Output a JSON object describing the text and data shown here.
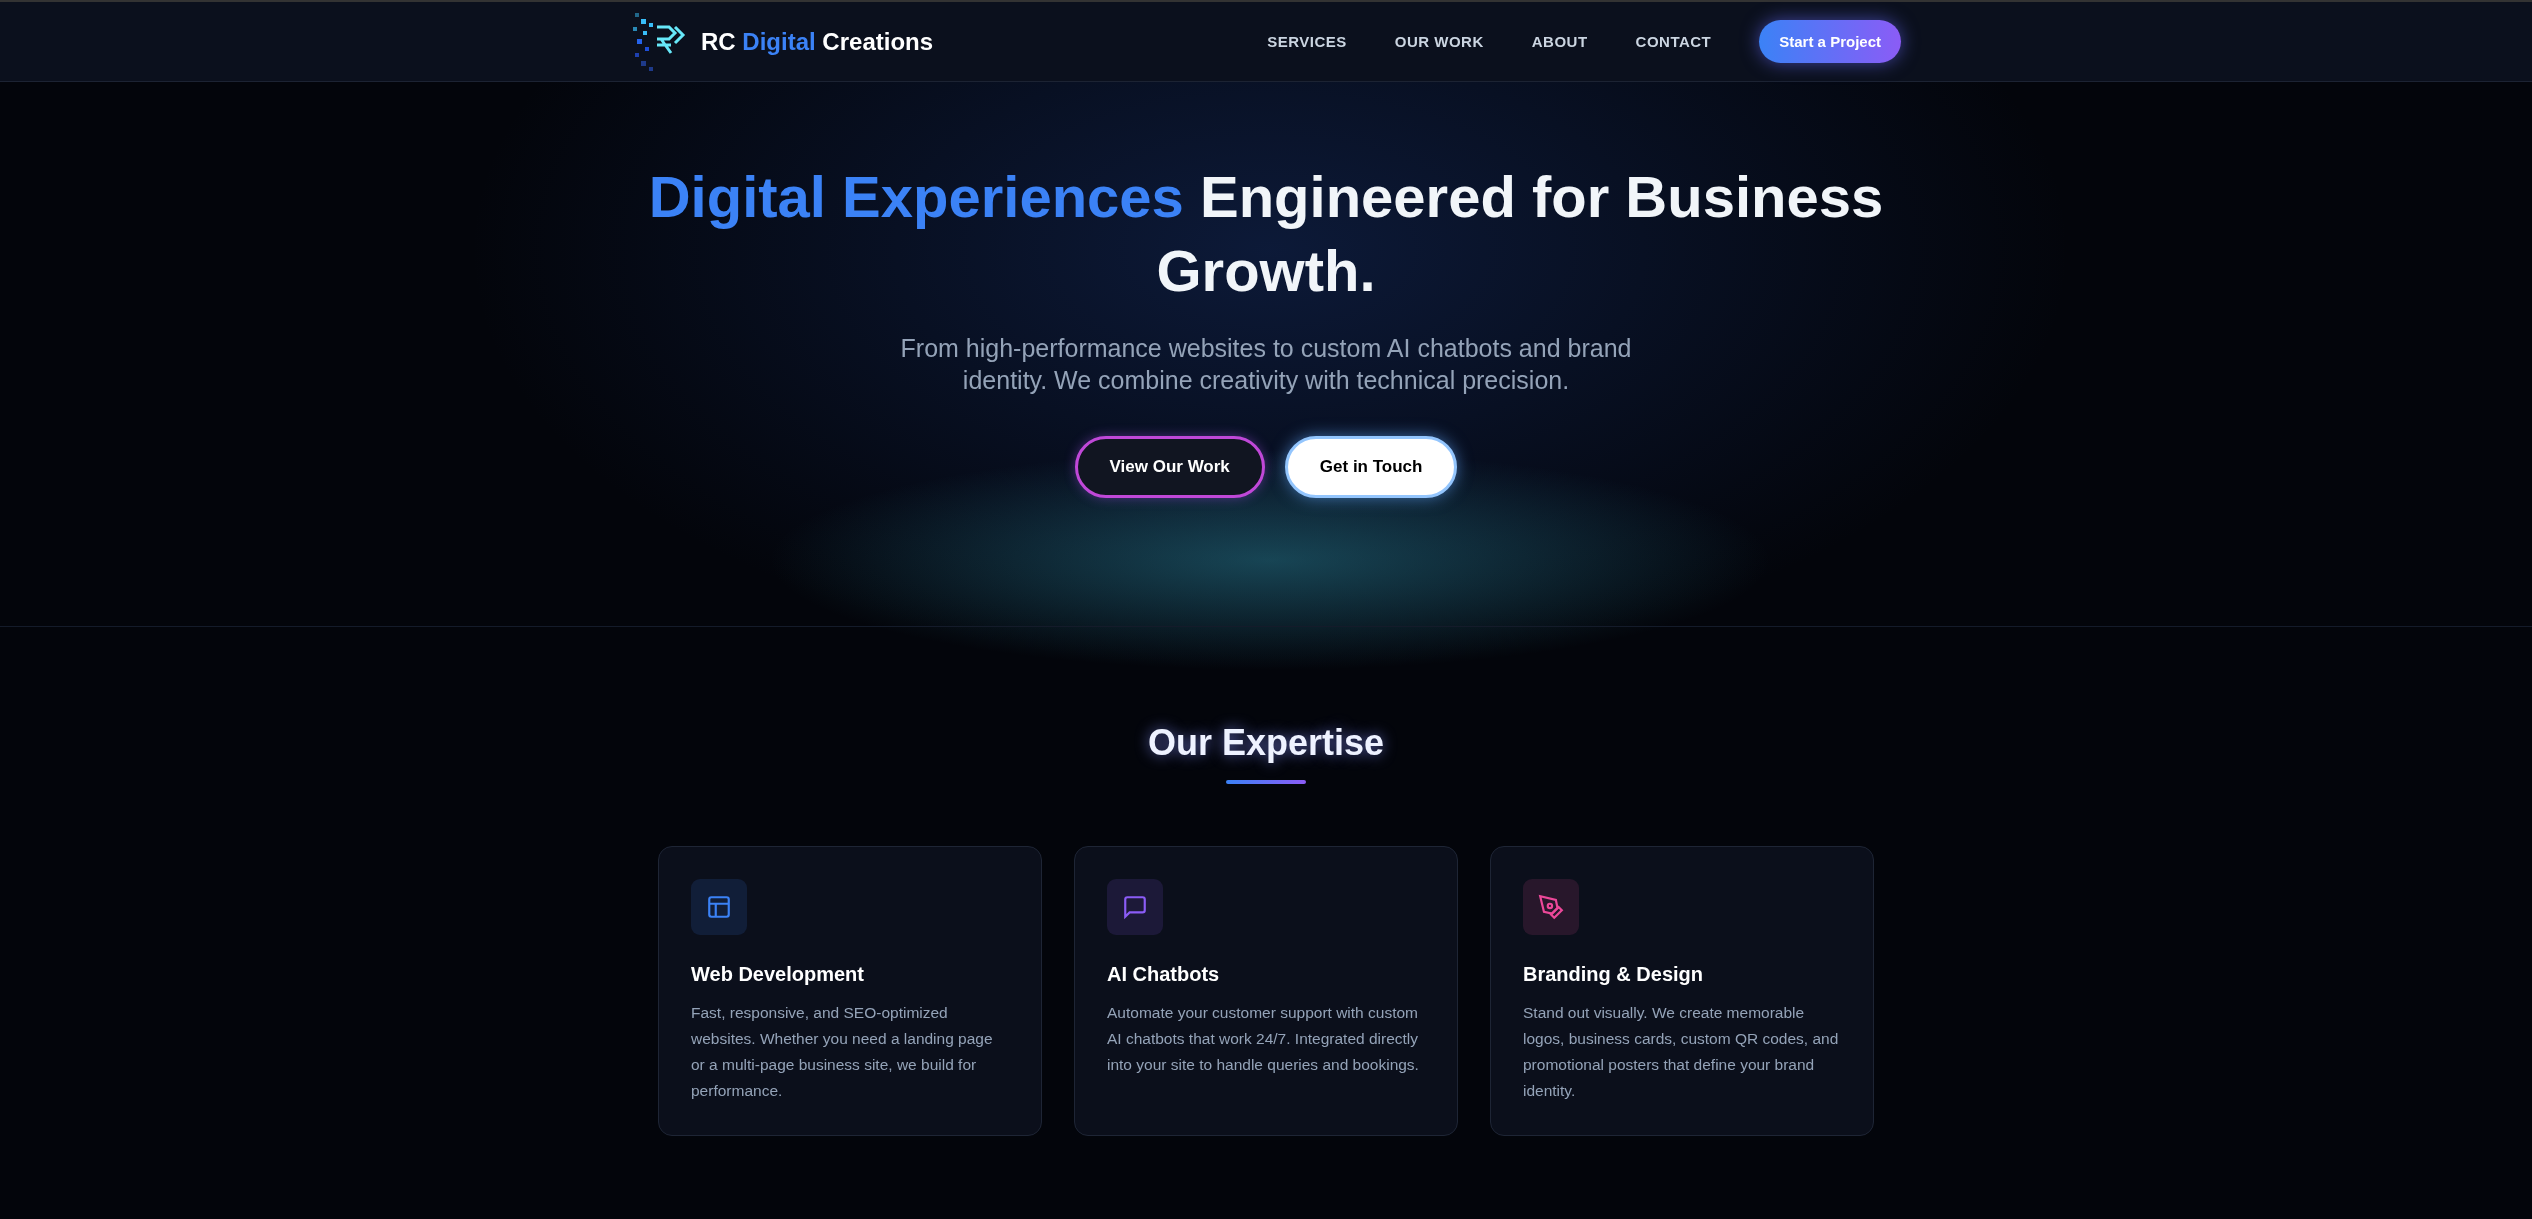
{
  "header": {
    "brand": {
      "first": "RC",
      "accent": "Digital",
      "last": "Creations"
    },
    "nav": [
      {
        "label": "SERVICES"
      },
      {
        "label": "OUR WORK"
      },
      {
        "label": "ABOUT"
      },
      {
        "label": "CONTACT"
      }
    ],
    "cta": "Start a Project"
  },
  "hero": {
    "title_highlight": "Digital Experiences",
    "title_rest": "Engineered for Business Growth.",
    "subtitle": "From high-performance websites to custom AI chatbots and brand identity. We combine creativity with technical precision.",
    "buttons": [
      {
        "label": "View Our Work",
        "kind": "outline"
      },
      {
        "label": "Get in Touch",
        "kind": "solid"
      }
    ]
  },
  "expertise": {
    "heading": "Our Expertise",
    "services": [
      {
        "title": "Web Development",
        "text": "Fast, responsive, and SEO-optimized websites. Whether you need a landing page or a multi-page business site, we build for performance.",
        "color": "#3b82f6"
      },
      {
        "title": "AI Chatbots",
        "text": "Automate your customer support with custom AI chatbots that work 24/7. Integrated directly into your site to handle queries and bookings.",
        "color": "#8b5cf6"
      },
      {
        "title": "Branding & Design",
        "text": "Stand out visually. We create memorable logos, business cards, custom QR codes, and promotional posters that define your brand identity.",
        "color": "#ec4899"
      }
    ]
  }
}
